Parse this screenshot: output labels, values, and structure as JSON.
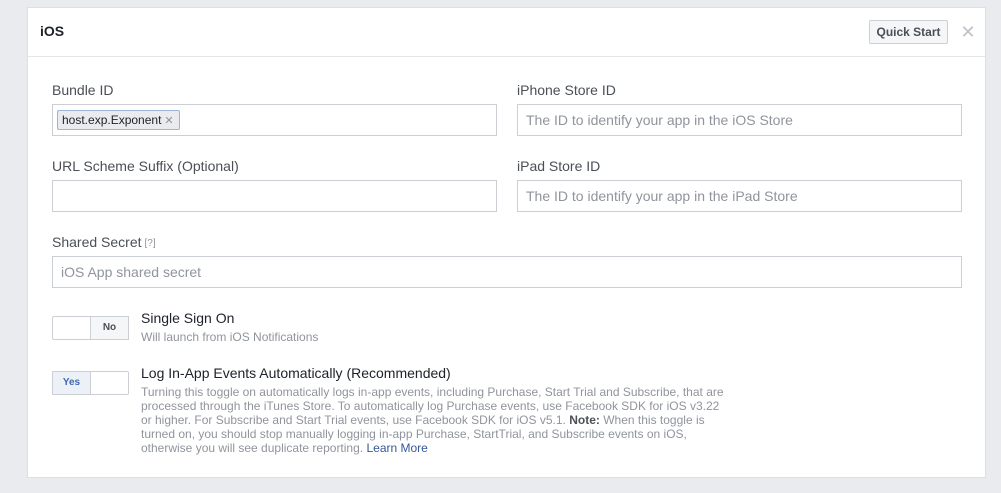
{
  "header": {
    "title": "iOS",
    "quick_start_label": "Quick Start",
    "close_glyph": "✕"
  },
  "fields": {
    "bundle_id": {
      "label": "Bundle ID",
      "token": "host.exp.Exponent",
      "token_remove": "✕"
    },
    "iphone_store_id": {
      "label": "iPhone Store ID",
      "placeholder": "The ID to identify your app in the iOS Store",
      "value": ""
    },
    "url_scheme_suffix": {
      "label": "URL Scheme Suffix (Optional)",
      "placeholder": "",
      "value": ""
    },
    "ipad_store_id": {
      "label": "iPad Store ID",
      "placeholder": "The ID to identify your app in the iPad Store",
      "value": ""
    },
    "shared_secret": {
      "label": "Shared Secret",
      "help": "[?]",
      "placeholder": "iOS App shared secret",
      "value": ""
    }
  },
  "options": {
    "single_sign_on": {
      "toggle_label": "No",
      "toggle_state": "off",
      "title": "Single Sign On",
      "subtitle": "Will launch from iOS Notifications"
    },
    "log_events": {
      "toggle_label": "Yes",
      "toggle_state": "on",
      "title": "Log In-App Events Automatically (Recommended)",
      "desc_part1": "Turning this toggle on automatically logs in-app events, including Purchase, Start Trial and Subscribe, that are processed through the iTunes Store. To automatically log Purchase events, use Facebook SDK for iOS v3.22 or higher. For Subscribe and Start Trial events, use Facebook SDK for iOS v5.1.",
      "note_label": "Note:",
      "desc_part2": "When this toggle is turned on, you should stop manually logging in-app Purchase, StartTrial, and Subscribe events on iOS, otherwise you will see duplicate reporting.",
      "learn_more": "Learn More"
    }
  },
  "colors": {
    "link": "#365899",
    "toggle_on": "#4267b2",
    "muted": "#90949c"
  }
}
